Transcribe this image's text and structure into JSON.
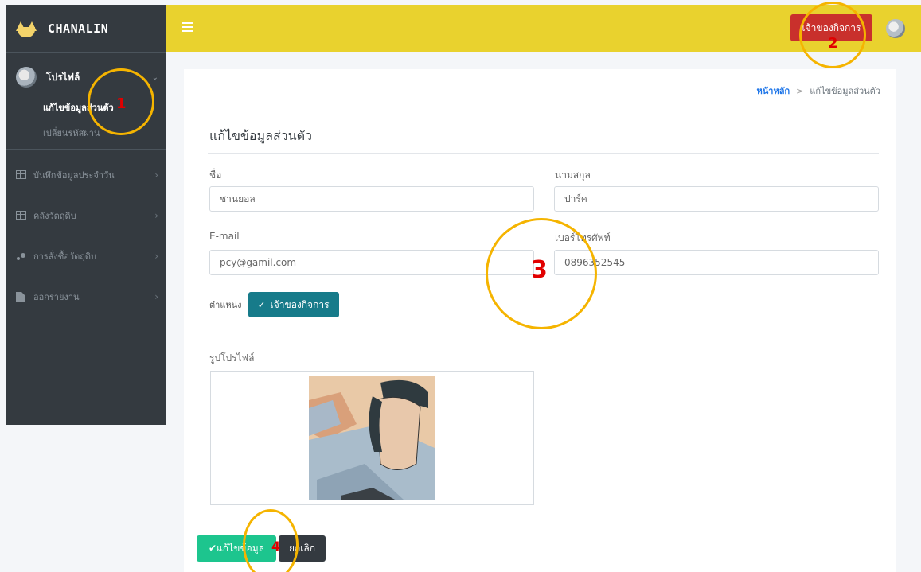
{
  "brand": {
    "name": "CHANALIN"
  },
  "sidebar": {
    "user_name": "โปรไฟล์",
    "sub_items": [
      {
        "label": "แก้ไขข้อมูลส่วนตัว",
        "active": true
      },
      {
        "label": "เปลี่ยนรหัสผ่าน",
        "active": false
      }
    ],
    "nav_items": [
      {
        "label": "บันทึกข้อมูลประจำวัน",
        "icon": "table-icon"
      },
      {
        "label": "คลังวัตถุดิบ",
        "icon": "table-icon"
      },
      {
        "label": "การสั่งซื้อวัตถุดิบ",
        "icon": "order-icon"
      },
      {
        "label": "ออกรายงาน",
        "icon": "file-icon"
      }
    ]
  },
  "topbar": {
    "role_button": "เจ้าของกิจการ"
  },
  "breadcrumb": {
    "home": "หน้าหลัก",
    "current": "แก้ไขข้อมูลส่วนตัว"
  },
  "form": {
    "title": "แก้ไขข้อมูลส่วนตัว",
    "first_name_label": "ชื่อ",
    "first_name_value": "ชานยอล",
    "last_name_label": "นามสกุล",
    "last_name_value": "ปาร์ค",
    "email_label": "E-mail",
    "email_value": "pcy@gamil.com",
    "phone_label": "เบอร์โทรศัพท์",
    "phone_value": "0896352545",
    "position_label": "ตำแหน่ง",
    "position_value": "เจ้าของกิจการ",
    "photo_label": "รูปโปรไฟล์",
    "save_label": "แก้ไขข้อมูล",
    "cancel_label": "ยกเลิก"
  },
  "annotations": [
    "1",
    "2",
    "3",
    "4"
  ],
  "colors": {
    "topbar": "#e9d22e",
    "sidebar": "#343a40",
    "role_button": "#c9302c",
    "badge": "#177b8a",
    "save": "#1dc58e",
    "annotation": "#f5b400",
    "annotation_number": "#e10000"
  }
}
